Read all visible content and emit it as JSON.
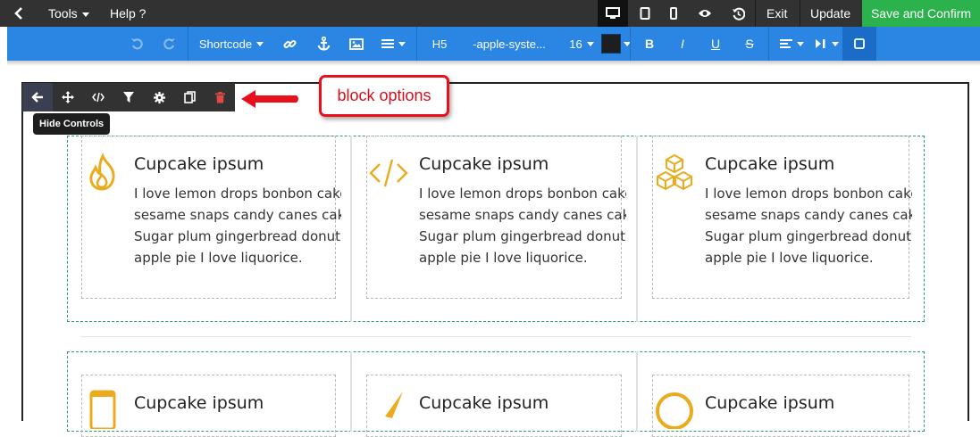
{
  "topbar": {
    "back_icon": "chevron-left-icon",
    "tools_label": "Tools",
    "help_label": "Help ?",
    "device_icons": [
      "desktop-icon",
      "tablet-icon",
      "mobile-icon"
    ],
    "preview_icon": "eye-icon",
    "history_icon": "history-icon",
    "exit_label": "Exit",
    "update_label": "Update",
    "save_confirm_label": "Save and Confirm",
    "save_color": "#2bb24c"
  },
  "format_bar": {
    "undo_icon": "undo-icon",
    "redo_icon": "redo-icon",
    "shortcode_label": "Shortcode",
    "link_icon": "link-icon",
    "anchor_icon": "anchor-icon",
    "image_icon": "image-icon",
    "list_icon": "list-icon",
    "heading_label": "H5",
    "font_label": "-apple-syste...",
    "size_label": "16",
    "color_value": "#1e1e1e",
    "bold_label": "B",
    "italic_label": "I",
    "underline_label": "U",
    "strike_label": "S",
    "align_icon": "align-left-icon",
    "media_icon": "media-icon",
    "block_icon": "square-icon",
    "bar_color": "#2b86e3"
  },
  "block_controls": {
    "icons": [
      "arrow-left-icon",
      "move-icon",
      "code-icon",
      "filter-icon",
      "gear-icon",
      "copy-icon",
      "trash-icon"
    ],
    "tooltip": "Hide Controls"
  },
  "annotation": {
    "label": "block options",
    "color": "#e8101b"
  },
  "rows": [
    {
      "columns": [
        {
          "icon": "fire-icon",
          "title": "Cupcake ipsum",
          "lines": [
            "I love lemon drops bonbon cake",
            "sesame snaps candy canes cake.",
            "Sugar plum gingerbread donut",
            "apple pie I love liquorice."
          ]
        },
        {
          "icon": "code-icon",
          "title": "Cupcake ipsum",
          "lines": [
            "I love lemon drops bonbon cake",
            "sesame snaps candy canes cake.",
            "Sugar plum gingerbread donut",
            "apple pie I love liquorice."
          ]
        },
        {
          "icon": "cubes-icon",
          "title": "Cupcake ipsum",
          "lines": [
            "I love lemon drops bonbon cake",
            "sesame snaps candy canes cake.",
            "Sugar plum gingerbread donut",
            "apple pie I love liquorice."
          ]
        }
      ]
    },
    {
      "columns": [
        {
          "icon": "mobile-icon",
          "title": "Cupcake ipsum"
        },
        {
          "icon": "pen-icon",
          "title": "Cupcake ipsum"
        },
        {
          "icon": "circle-icon",
          "title": "Cupcake ipsum"
        }
      ]
    }
  ],
  "icon_color": "#eaab1e"
}
